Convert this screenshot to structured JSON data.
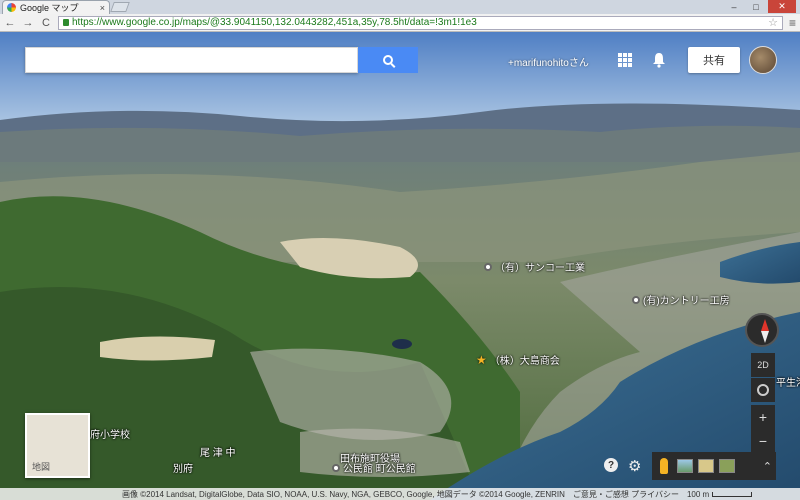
{
  "browser": {
    "tab_title": "Google マップ",
    "tab_close": "×",
    "url": "https://www.google.co.jp/maps/@33.9041150,132.0443282,451a,35y,78.5ht/data=!3m1!1e3",
    "window_controls": {
      "minimize": "–",
      "maximize": "□",
      "close": "✕"
    },
    "nav": {
      "back": "←",
      "forward": "→",
      "reload": "C"
    },
    "bookmark_star": "☆",
    "menu": "≡"
  },
  "header": {
    "search_placeholder": "",
    "user_name": "+marifunohitoさん",
    "share_label": "共有"
  },
  "places": [
    {
      "id": "sanko",
      "label": "（有）サンコー工業"
    },
    {
      "id": "country",
      "label": "(有)カントリー工房"
    },
    {
      "id": "oshima",
      "label": "（株）大島商会"
    },
    {
      "id": "tabuse-hall",
      "label": "田布施町役場"
    },
    {
      "id": "kouminkan",
      "label": "公民館 町公民館"
    }
  ],
  "area_labels": {
    "school": "府小学校",
    "ozu": "尾 津 中",
    "befu": "別府",
    "hirao_port": "平生港"
  },
  "minimap": {
    "label": "地図"
  },
  "controls": {
    "tilt_label": "2D",
    "zoom_in": "+",
    "zoom_out": "−",
    "help": "?",
    "settings": "⚙",
    "expand": "⌃"
  },
  "attribution": {
    "text": "画像 ©2014 Landsat, DigitalGlobe, Data SIO, NOAA, U.S. Navy, NGA, GEBCO, Google, 地図データ ©2014 Google, ZENRIN",
    "links": "ご意見・ご感想   プライバシー",
    "scale": "100 m"
  },
  "colors": {
    "search_blue": "#4a8af4",
    "sky_top": "#4f7fc4",
    "sea": "#2e5f88"
  },
  "icons": [
    "google-favicon",
    "lock-icon",
    "star-icon",
    "search-icon",
    "apps-icon",
    "bell-icon",
    "compass-icon",
    "mylocation-icon",
    "pegman-icon",
    "help-icon",
    "gear-icon"
  ]
}
